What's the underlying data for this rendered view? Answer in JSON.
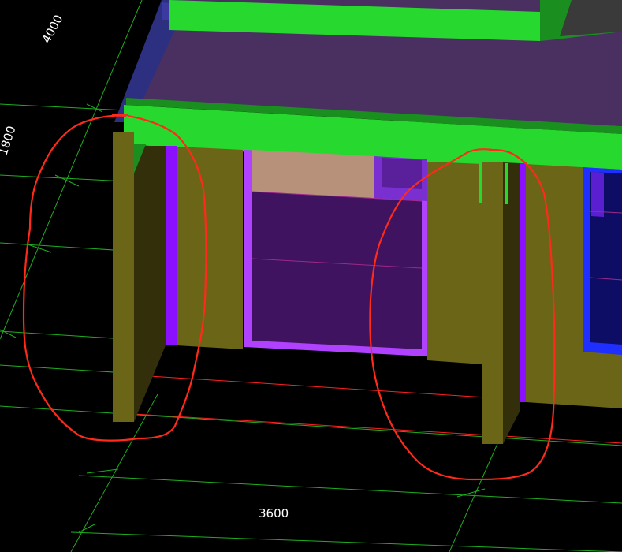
{
  "dimensions": {
    "left_top": "4000",
    "left_mid": "1800",
    "bottom": "3600"
  },
  "colors": {
    "background": "#000000",
    "grid_green": "#1fae1f",
    "grid_red": "#ff2020",
    "beam_green": "#27d92e",
    "beam_green_dark": "#1a8f1f",
    "slab_purple": "#4a3060",
    "slab_blue": "#2d2f80",
    "wall_olive": "#6b6517",
    "wall_olive_dark": "#332f0b",
    "opening_purple": "#b041ff",
    "opening_fill": "#3f135f",
    "panel_tan": "#b7917a",
    "window_blue": "#1f2fff",
    "window_fill": "#0e0d66",
    "annotation_red": "#ff2a1a"
  }
}
